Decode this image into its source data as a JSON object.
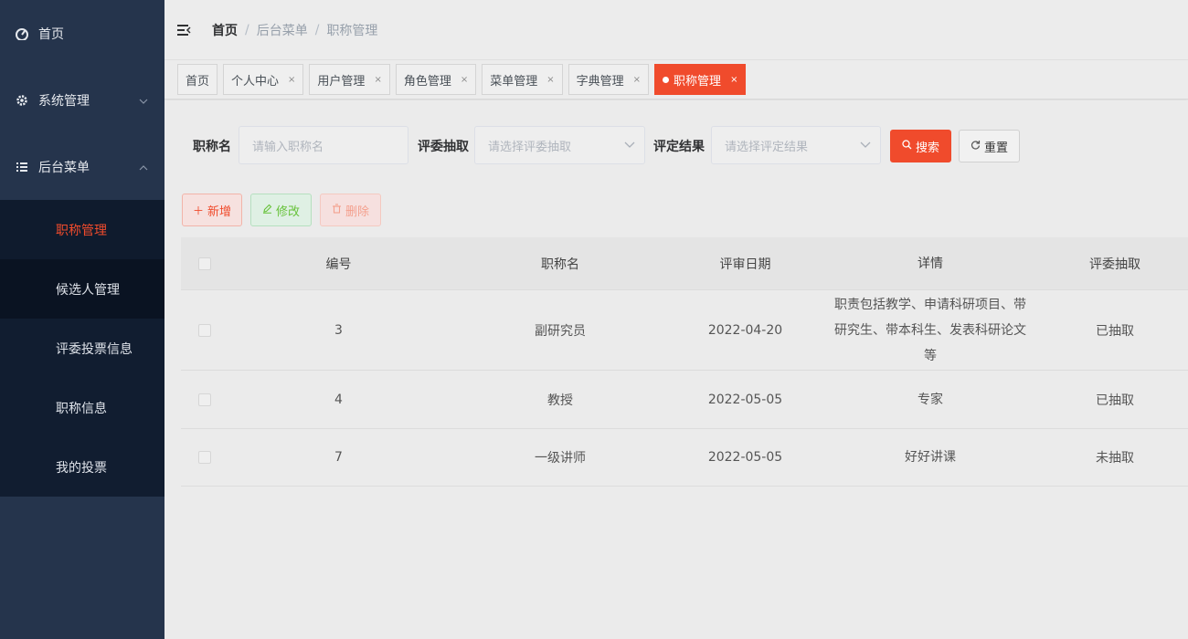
{
  "sidebar": {
    "items": [
      {
        "label": "首页",
        "icon": "dashboard-icon"
      },
      {
        "label": "系统管理",
        "icon": "gear-icon"
      },
      {
        "label": "后台菜单",
        "icon": "list-icon"
      }
    ],
    "submenu": [
      {
        "label": "职称管理",
        "active": true
      },
      {
        "label": "候选人管理"
      },
      {
        "label": "评委投票信息"
      },
      {
        "label": "职称信息"
      },
      {
        "label": "我的投票"
      }
    ]
  },
  "breadcrumb": [
    "首页",
    "后台菜单",
    "职称管理"
  ],
  "tags": [
    {
      "label": "首页",
      "closable": false
    },
    {
      "label": "个人中心",
      "closable": true
    },
    {
      "label": "用户管理",
      "closable": true
    },
    {
      "label": "角色管理",
      "closable": true
    },
    {
      "label": "菜单管理",
      "closable": true
    },
    {
      "label": "字典管理",
      "closable": true
    },
    {
      "label": "职称管理",
      "closable": true,
      "active": true
    }
  ],
  "close_glyph": "×",
  "search": {
    "name_label": "职称名",
    "name_placeholder": "请输入职称名",
    "judge_label": "评委抽取",
    "judge_placeholder": "请选择评委抽取",
    "result_label": "评定结果",
    "result_placeholder": "请选择评定结果",
    "search_button": "搜索",
    "reset_button": "重置"
  },
  "actions": {
    "add": "新增",
    "edit": "修改",
    "delete": "删除"
  },
  "table": {
    "headers": [
      "编号",
      "职称名",
      "评审日期",
      "详情",
      "评委抽取"
    ],
    "rows": [
      {
        "id": "3",
        "name": "副研究员",
        "date": "2022-04-20",
        "detail": "职责包括教学、申请科研项目、带研究生、带本科生、发表科研论文等",
        "status": "已抽取"
      },
      {
        "id": "4",
        "name": "教授",
        "date": "2022-05-05",
        "detail": "专家",
        "status": "已抽取"
      },
      {
        "id": "7",
        "name": "一级讲师",
        "date": "2022-05-05",
        "detail": "好好讲课",
        "status": "未抽取"
      }
    ]
  },
  "colors": {
    "accent": "#f04b2c",
    "sidebar_bg": "#25344c",
    "submenu_bg": "#111d30",
    "edit_green": "#67c23a"
  }
}
